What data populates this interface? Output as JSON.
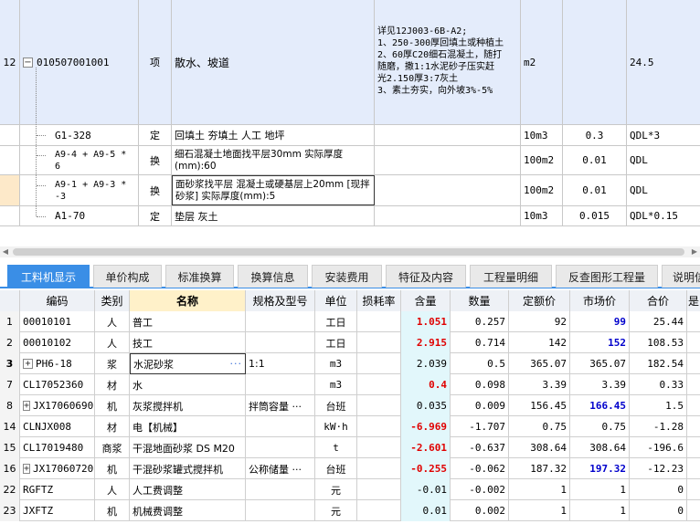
{
  "top_table": {
    "main_row": {
      "num": "12",
      "code": "010507001001",
      "type": "项",
      "name": "散水、坡道",
      "feature_lines": [
        "详见12J003-6B-A2;",
        "1、250-300厚回填土或种植土",
        "2、60厚C20细石混凝土，随打",
        "随磨，撒1:1水泥砂子压实赶",
        "光2.150厚3:7灰土",
        "3、素土夯实，向外坡3%-5%"
      ],
      "unit": "m2",
      "qty_expr": "24.5"
    },
    "sub_rows": [
      {
        "code": "G1-328",
        "type": "定",
        "name": "回填土 夯填土 人工 地坪",
        "unit": "10m3",
        "qty": "0.3",
        "expr": "QDL*3"
      },
      {
        "code": "A9-4 + A9-5 * 6",
        "type": "换",
        "name": "细石混凝土地面找平层30mm  实际厚度(mm):60",
        "unit": "100m2",
        "qty": "0.01",
        "expr": "QDL"
      },
      {
        "code": "A9-1 + A9-3 * -3",
        "type": "换",
        "name": "面砂浆找平层 混凝土或硬基层上20mm  [现拌砂浆]  实际厚度(mm):5",
        "unit": "100m2",
        "qty": "0.01",
        "expr": "QDL"
      },
      {
        "code": "A1-70",
        "type": "定",
        "name": "垫层 灰土",
        "unit": "10m3",
        "qty": "0.015",
        "expr": "QDL*0.15"
      }
    ]
  },
  "tabs": [
    "工料机显示",
    "单价构成",
    "标准换算",
    "换算信息",
    "安装费用",
    "特征及内容",
    "工程量明细",
    "反查图形工程量",
    "说明信"
  ],
  "grid": {
    "headers": [
      "",
      "编码",
      "类别",
      "名称",
      "规格及型号",
      "单位",
      "损耗率",
      "含量",
      "数量",
      "定额价",
      "市场价",
      "合价",
      "是"
    ],
    "rows": [
      {
        "n": "1",
        "code": "00010101",
        "cat": "人",
        "name": "普工",
        "spec": "",
        "unit": "工日",
        "loss": "",
        "content": "1.051",
        "content_red": true,
        "qty": "0.257",
        "price": "92",
        "market": "99",
        "market_blue": true,
        "total": "25.44"
      },
      {
        "n": "2",
        "code": "00010102",
        "cat": "人",
        "name": "技工",
        "spec": "",
        "unit": "工日",
        "loss": "",
        "content": "2.915",
        "content_red": true,
        "qty": "0.714",
        "price": "142",
        "market": "152",
        "market_blue": true,
        "total": "108.53"
      },
      {
        "n": "3",
        "code": "PH6-18",
        "cat": "浆",
        "name": "水泥砂浆",
        "spec": "1:1",
        "unit": "m3",
        "loss": "",
        "content": "2.039",
        "content_red": false,
        "qty": "0.5",
        "price": "365.07",
        "market": "365.07",
        "market_blue": false,
        "total": "182.54",
        "expand": true,
        "editing": true
      },
      {
        "n": "7",
        "code": "CL17052360",
        "cat": "材",
        "name": "水",
        "spec": "",
        "unit": "m3",
        "loss": "",
        "content": "0.4",
        "content_red": true,
        "qty": "0.098",
        "price": "3.39",
        "market": "3.39",
        "market_blue": false,
        "total": "0.33"
      },
      {
        "n": "8",
        "code": "JX17060690",
        "cat": "机",
        "name": "灰浆搅拌机",
        "spec": "拌筒容量 ···",
        "unit": "台班",
        "loss": "",
        "content": "0.035",
        "content_red": false,
        "qty": "0.009",
        "price": "156.45",
        "market": "166.45",
        "market_blue": true,
        "total": "1.5",
        "expand": true
      },
      {
        "n": "14",
        "code": "CLNJX008",
        "cat": "材",
        "name": "电【机械】",
        "spec": "",
        "unit": "kW·h",
        "loss": "",
        "content": "-6.969",
        "content_red": true,
        "qty": "-1.707",
        "price": "0.75",
        "market": "0.75",
        "market_blue": false,
        "total": "-1.28"
      },
      {
        "n": "15",
        "code": "CL17019480",
        "cat": "商浆",
        "name": "干混地面砂浆 DS M20",
        "spec": "",
        "unit": "t",
        "loss": "",
        "content": "-2.601",
        "content_red": true,
        "qty": "-0.637",
        "price": "308.64",
        "market": "308.64",
        "market_blue": false,
        "total": "-196.6"
      },
      {
        "n": "16",
        "code": "JX17060720",
        "cat": "机",
        "name": "干混砂浆罐式搅拌机",
        "spec": "公称储量 ···",
        "unit": "台班",
        "loss": "",
        "content": "-0.255",
        "content_red": true,
        "qty": "-0.062",
        "price": "187.32",
        "market": "197.32",
        "market_blue": true,
        "total": "-12.23",
        "expand": true
      },
      {
        "n": "22",
        "code": "RGFTZ",
        "cat": "人",
        "name": "人工费调整",
        "spec": "",
        "unit": "元",
        "loss": "",
        "content": "-0.01",
        "content_red": false,
        "qty": "-0.002",
        "price": "1",
        "market": "1",
        "market_blue": false,
        "total": "0"
      },
      {
        "n": "23",
        "code": "JXFTZ",
        "cat": "机",
        "name": "机械费调整",
        "spec": "",
        "unit": "元",
        "loss": "",
        "content": "0.01",
        "content_red": false,
        "qty": "0.002",
        "price": "1",
        "market": "1",
        "market_blue": false,
        "total": "0"
      }
    ]
  },
  "colors": {
    "tab_active": "#3a8ee6",
    "selected_row": "#e4ecfb",
    "content_highlight": "#e2f7fb",
    "red": "#e00000",
    "blue": "#0000cc",
    "name_header": "#fff1c9"
  },
  "icons": {
    "collapse": "minus-box-icon",
    "expand": "plus-box-icon",
    "more": "ellipsis-icon"
  }
}
